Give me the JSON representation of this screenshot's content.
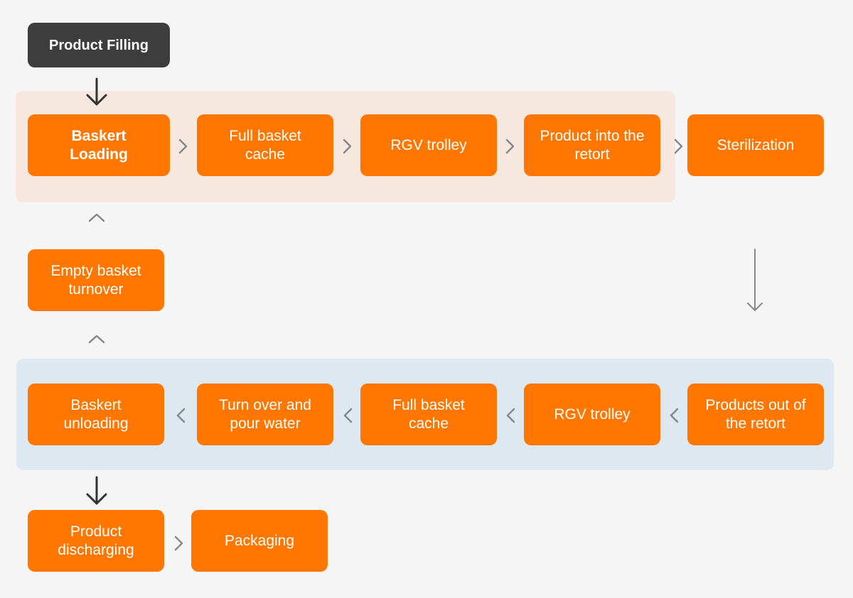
{
  "start": {
    "label": "Product Filling"
  },
  "loading_group": {
    "color": "#f6e8de",
    "steps": [
      {
        "label": "Baskert Loading"
      },
      {
        "label": "Full basket cache"
      },
      {
        "label": "RGV trolley"
      },
      {
        "label": "Product into the retort"
      },
      {
        "label": "Sterilization"
      }
    ]
  },
  "return_step": {
    "label": "Empty basket turnover"
  },
  "unloading_group": {
    "color": "#dde8f0",
    "steps": [
      {
        "label": "Baskert unloading"
      },
      {
        "label": "Turn over and pour water"
      },
      {
        "label": "Full basket cache"
      },
      {
        "label": "RGV trolley"
      },
      {
        "label": "Products out of the retort"
      }
    ]
  },
  "final_steps": [
    {
      "label": "Product discharging"
    },
    {
      "label": "Packaging"
    }
  ],
  "colors": {
    "step": "#ff7700",
    "start": "#3d3d3d",
    "arrow": "#888888",
    "arrow_dark": "#333333"
  }
}
